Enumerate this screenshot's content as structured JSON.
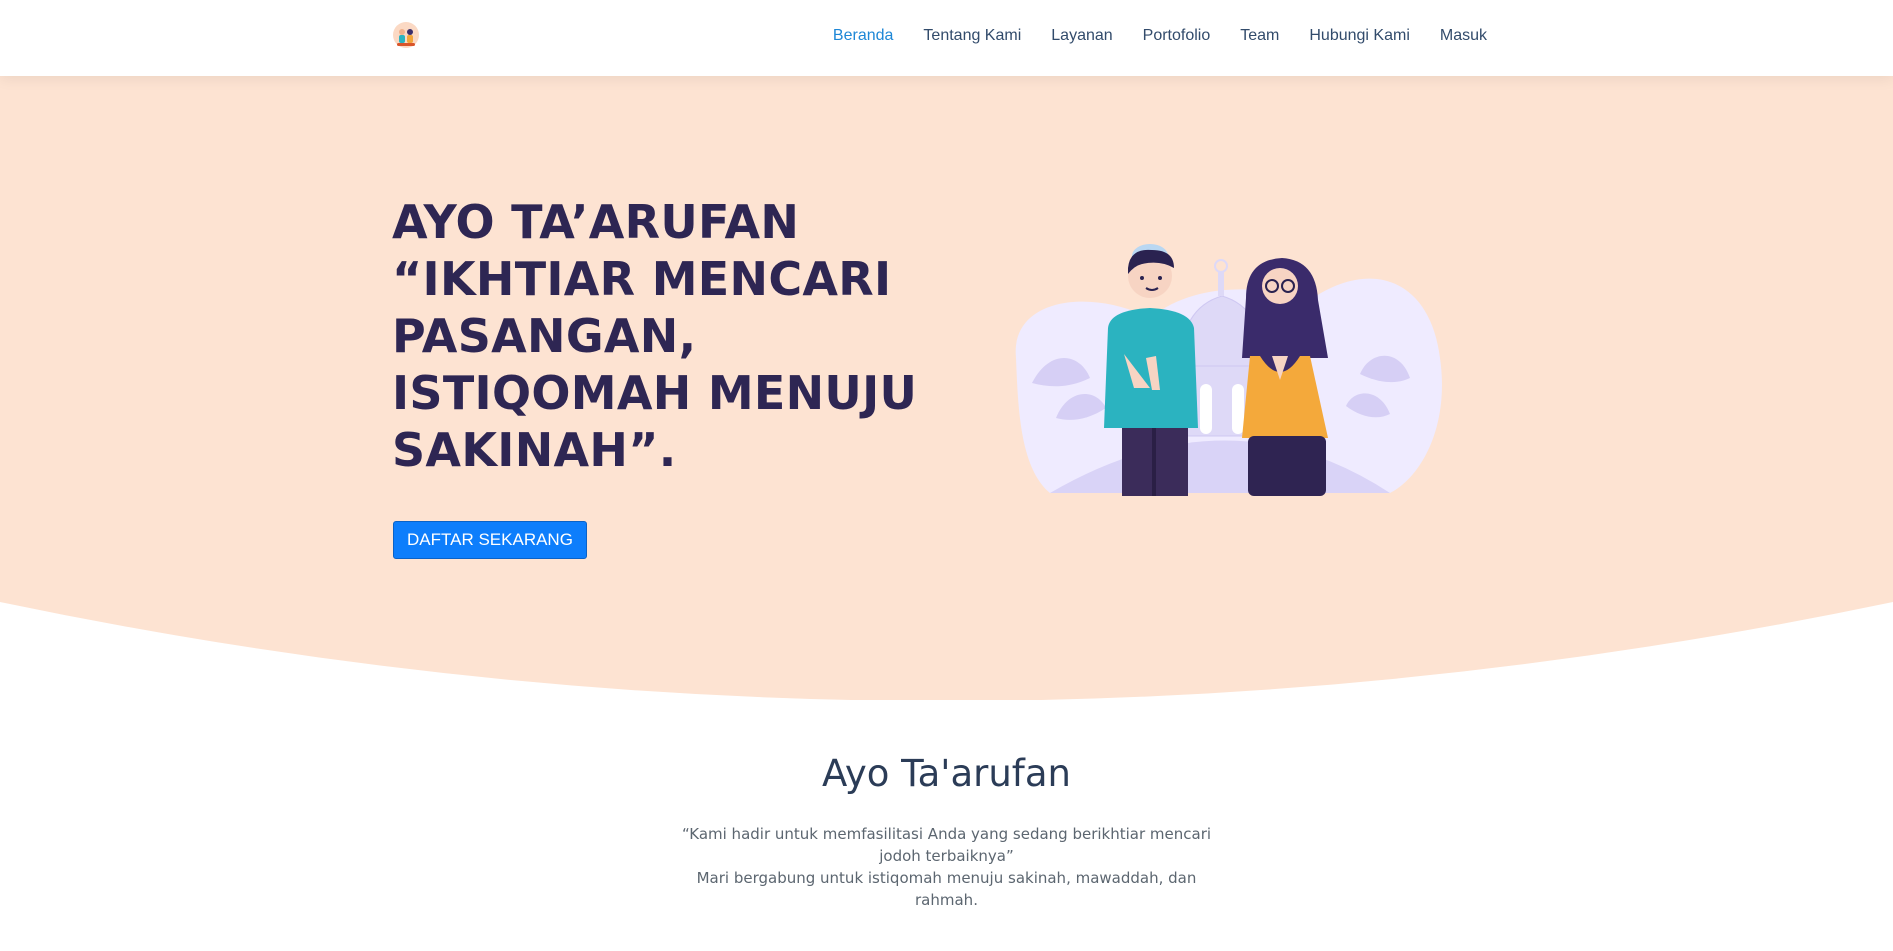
{
  "nav": {
    "logo_icon": "couple-logo-icon",
    "items": [
      {
        "label": "Beranda",
        "active": true
      },
      {
        "label": "Tentang Kami",
        "active": false
      },
      {
        "label": "Layanan",
        "active": false
      },
      {
        "label": "Portofolio",
        "active": false
      },
      {
        "label": "Team",
        "active": false
      },
      {
        "label": "Hubungi Kami",
        "active": false
      },
      {
        "label": "Masuk",
        "active": false
      }
    ]
  },
  "hero": {
    "title_lines": [
      "AYO TA’ARUFAN",
      "“IKHTIAR MENCARI",
      "PASANGAN,",
      "ISTIQOMAH MENUJU",
      "SAKINAH”."
    ],
    "cta_label": "DAFTAR SEKARANG",
    "illustration_icon": "muslim-couple-mosque-illustration"
  },
  "intro": {
    "title": "Ayo Ta'arufan",
    "lines": [
      "“Kami hadir untuk memfasilitasi Anda yang sedang berikhtiar mencari jodoh terbaiknya”",
      "Mari bergabung untuk istiqomah menuju sakinah, mawaddah, dan rahmah."
    ]
  },
  "colors": {
    "hero_bg": "#fde3d2",
    "title": "#2e2653",
    "accent": "#1e87d6",
    "button": "#0d7efc"
  }
}
